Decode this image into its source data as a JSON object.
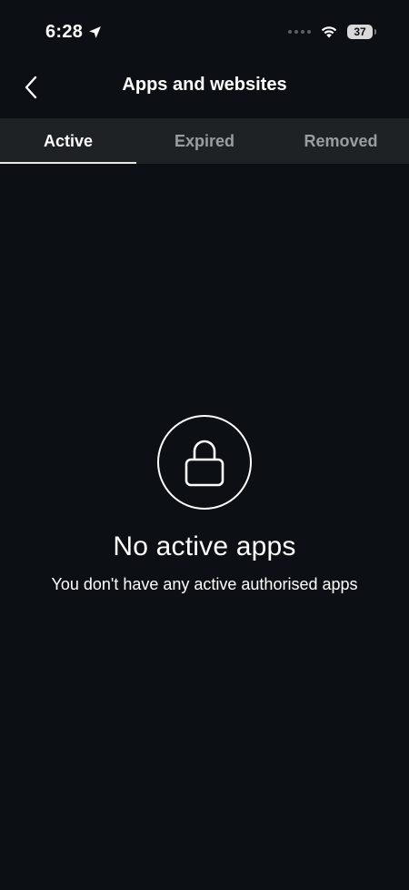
{
  "status_bar": {
    "time": "6:28",
    "battery_level": "37",
    "icons": [
      "location-arrow-icon",
      "signal-dots-icon",
      "wifi-icon",
      "battery-icon"
    ]
  },
  "header": {
    "title": "Apps and websites",
    "back_icon": "chevron-left-icon"
  },
  "tabs": [
    {
      "label": "Active",
      "active": true
    },
    {
      "label": "Expired",
      "active": false
    },
    {
      "label": "Removed",
      "active": false
    }
  ],
  "empty_state": {
    "icon": "lock-icon",
    "title": "No active apps",
    "subtitle": "You don't have any active authorised apps"
  },
  "colors": {
    "background": "#0c1014",
    "tab_bar": "#1f2225",
    "inactive_tab_text": "#9a9ea3",
    "text": "#ffffff"
  }
}
